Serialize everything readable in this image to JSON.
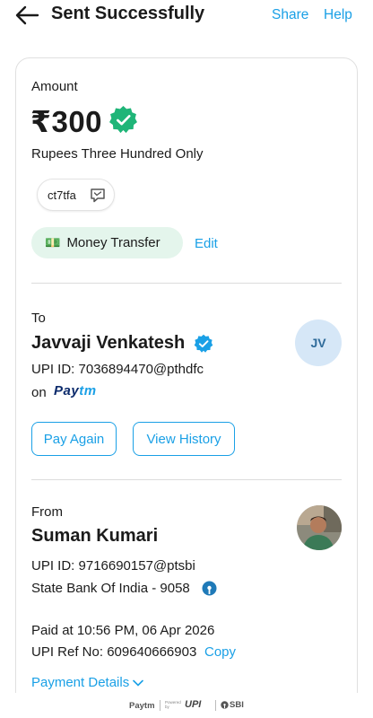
{
  "header": {
    "title": "Sent Successfully",
    "share_label": "Share",
    "help_label": "Help"
  },
  "payment": {
    "amount_label": "Amount",
    "amount": "₹300",
    "amount_words": "Rupees Three Hundred Only",
    "note": "ct7tfa",
    "category_emoji": "💵",
    "category": "Money Transfer",
    "edit_label": "Edit"
  },
  "to": {
    "label": "To",
    "name": "Javvaji Venkatesh",
    "upi_id": "UPI ID: 7036894470@pthdfc",
    "on_label": "on",
    "app_logo_text": "Paytm",
    "initials": "JV",
    "pay_again_label": "Pay Again",
    "view_history_label": "View History"
  },
  "from": {
    "label": "From",
    "name": "Suman Kumari",
    "upi_id": "UPI ID: 9716690157@ptsbi",
    "bank": "State Bank Of India - 9058"
  },
  "details": {
    "paid_at": "Paid at 10:56 PM, 06 Apr 2026",
    "ref_no": "UPI Ref No: 609640666903",
    "copy_label": "Copy",
    "payment_details_label": "Payment Details"
  },
  "footer": {
    "paytm": "Paytm",
    "powered_by": "Powered by",
    "upi": "UPI",
    "sbi": "SBI"
  },
  "colors": {
    "accent": "#1aa0e6",
    "verified": "#1fb578",
    "pill_bg": "#e4f5ec",
    "paytm_navy": "#0b2a6b"
  }
}
